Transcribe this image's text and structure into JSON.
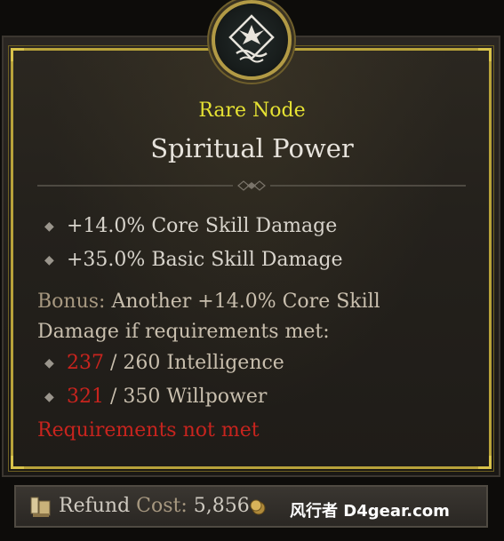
{
  "node": {
    "rarity": "Rare Node",
    "name": "Spiritual Power",
    "emblem_icon": "spirit-feather-icon"
  },
  "stats": [
    {
      "text": "+14.0% Core Skill Damage"
    },
    {
      "text": "+35.0% Basic Skill Damage"
    }
  ],
  "bonus": {
    "label": "Bonus:",
    "text": " Another +14.0% Core Skill Damage if requirements met:"
  },
  "requirements": [
    {
      "current": "237",
      "rest": " / 260 Intelligence"
    },
    {
      "current": "321",
      "rest": " / 350 Willpower"
    }
  ],
  "requirements_warning": "Requirements not met",
  "footer": {
    "refund": "Refund",
    "cost_label": " Cost:",
    "cost_value": " 5,856",
    "watermark": "风行者 D4gear.com"
  },
  "colors": {
    "rarity": "#e6e233",
    "requirement_unmet": "#c8241e",
    "border_gold": "#b8a23a"
  }
}
